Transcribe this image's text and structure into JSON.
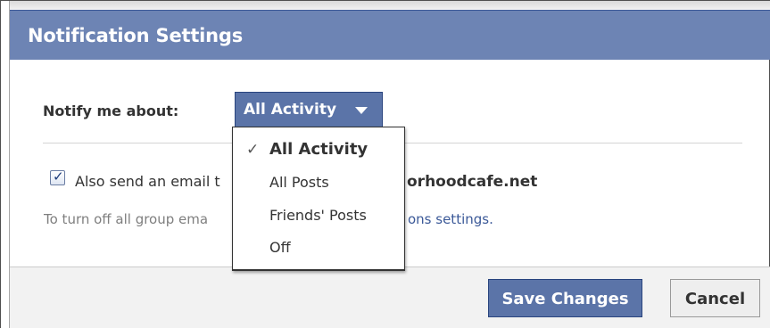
{
  "dialog": {
    "title": "Notification Settings"
  },
  "notify": {
    "label": "Notify me about:",
    "selected": "All Activity",
    "options": [
      "All Activity",
      "All Posts",
      "Friends' Posts",
      "Off"
    ]
  },
  "email": {
    "checked": true,
    "text_visible": "Also send an email t",
    "domain_visible": "orhoodcafe.net"
  },
  "turnoff": {
    "text_visible": "To turn off all group ema",
    "link_visible": "ons settings."
  },
  "buttons": {
    "save": "Save Changes",
    "cancel": "Cancel"
  },
  "colors": {
    "header": "#6d84b4",
    "primary_button": "#5b74a8",
    "link": "#3b5998"
  }
}
